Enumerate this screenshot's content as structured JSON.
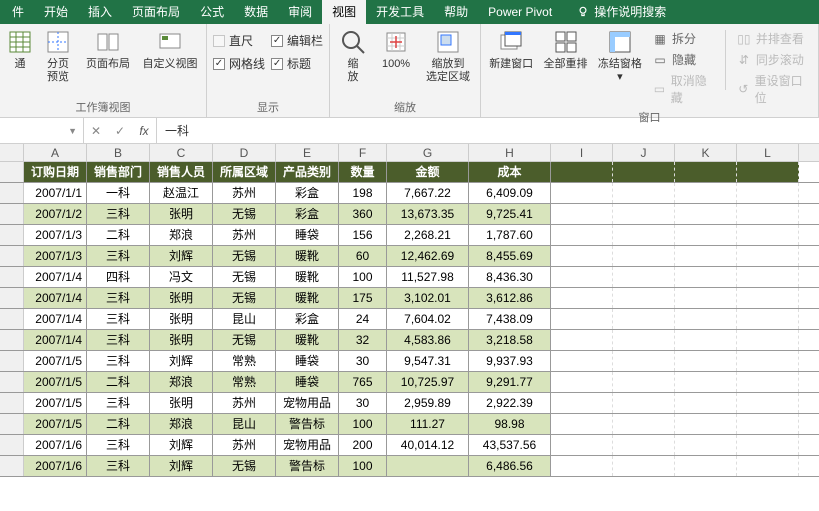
{
  "tabs": {
    "items": [
      "件",
      "开始",
      "插入",
      "页面布局",
      "公式",
      "数据",
      "审阅",
      "视图",
      "开发工具",
      "帮助",
      "Power Pivot"
    ],
    "active": 7,
    "search": "操作说明搜索"
  },
  "ribbon": {
    "g1": {
      "label": "工作簿视图",
      "normal": "通",
      "page_preview": "分页\n预览",
      "page_layout": "页面布局",
      "custom_view": "自定义视图"
    },
    "g2": {
      "label": "显示",
      "ruler": "直尺",
      "formula_bar": "编辑栏",
      "gridlines": "网格线",
      "headings": "标题",
      "ruler_on": false,
      "formula_bar_on": true,
      "gridlines_on": true,
      "headings_on": true
    },
    "g3": {
      "label": "缩放",
      "zoom": "缩\n放",
      "z100": "100%",
      "zoom_selection": "缩放到\n选定区域"
    },
    "g4": {
      "label": "窗口",
      "new_window": "新建窗口",
      "arrange_all": "全部重排",
      "freeze": "冻结窗格",
      "split": "拆分",
      "hide": "隐藏",
      "unhide": "取消隐藏",
      "side_by_side": "并排查看",
      "sync_scroll": "同步滚动",
      "reset_pos": "重设窗口位"
    }
  },
  "formula_bar": {
    "name": "",
    "value": "一科"
  },
  "columns": [
    "A",
    "B",
    "C",
    "D",
    "E",
    "F",
    "G",
    "H",
    "I",
    "J",
    "K",
    "L"
  ],
  "col_widths": {
    "A": 63,
    "B": 63,
    "C": 63,
    "D": 63,
    "E": 63,
    "F": 48,
    "G": 82,
    "H": 82,
    "I": 62,
    "J": 62,
    "K": 62,
    "L": 62
  },
  "headers": [
    "订购日期",
    "销售部门",
    "销售人员",
    "所属区域",
    "产品类别",
    "数量",
    "金额",
    "成本"
  ],
  "rows": [
    [
      "2007/1/1",
      "一科",
      "赵温江",
      "苏州",
      "彩盒",
      "198",
      "7,667.22",
      "6,409.09"
    ],
    [
      "2007/1/2",
      "三科",
      "张明",
      "无锡",
      "彩盒",
      "360",
      "13,673.35",
      "9,725.41"
    ],
    [
      "2007/1/3",
      "二科",
      "郑浪",
      "苏州",
      "睡袋",
      "156",
      "2,268.21",
      "1,787.60"
    ],
    [
      "2007/1/3",
      "三科",
      "刘辉",
      "无锡",
      "暖靴",
      "60",
      "12,462.69",
      "8,455.69"
    ],
    [
      "2007/1/4",
      "四科",
      "冯文",
      "无锡",
      "暖靴",
      "100",
      "11,527.98",
      "8,436.30"
    ],
    [
      "2007/1/4",
      "三科",
      "张明",
      "无锡",
      "暖靴",
      "175",
      "3,102.01",
      "3,612.86"
    ],
    [
      "2007/1/4",
      "三科",
      "张明",
      "昆山",
      "彩盒",
      "24",
      "7,604.02",
      "7,438.09"
    ],
    [
      "2007/1/4",
      "三科",
      "张明",
      "无锡",
      "暖靴",
      "32",
      "4,583.86",
      "3,218.58"
    ],
    [
      "2007/1/5",
      "三科",
      "刘辉",
      "常熟",
      "睡袋",
      "30",
      "9,547.31",
      "9,937.93"
    ],
    [
      "2007/1/5",
      "二科",
      "郑浪",
      "常熟",
      "睡袋",
      "765",
      "10,725.97",
      "9,291.77"
    ],
    [
      "2007/1/5",
      "三科",
      "张明",
      "苏州",
      "宠物用品",
      "30",
      "2,959.89",
      "2,922.39"
    ],
    [
      "2007/1/5",
      "二科",
      "郑浪",
      "昆山",
      "警告标",
      "100",
      "111.27",
      "98.98"
    ],
    [
      "2007/1/6",
      "三科",
      "刘辉",
      "苏州",
      "宠物用品",
      "200",
      "40,014.12",
      "43,537.56"
    ],
    [
      "2007/1/6",
      "三科",
      "刘辉",
      "无锡",
      "警告标",
      "100",
      "",
      "6,486.56"
    ]
  ],
  "colors": {
    "header_bg": "#4b5d2b",
    "even_bg": "#d8e4bc"
  }
}
